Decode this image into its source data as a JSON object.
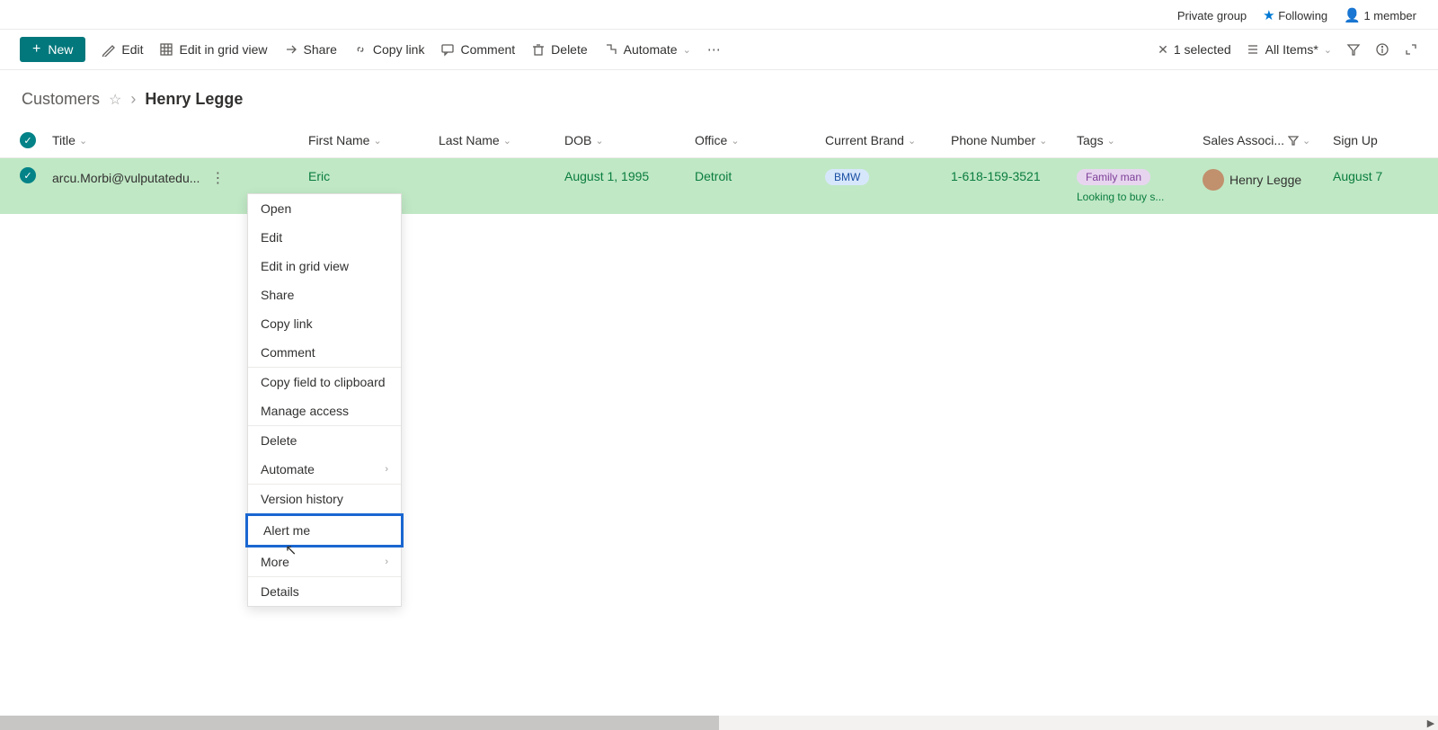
{
  "top": {
    "privacy": "Private group",
    "following": "Following",
    "members": "1 member"
  },
  "actions": {
    "new": "New",
    "edit": "Edit",
    "editGrid": "Edit in grid view",
    "share": "Share",
    "copyLink": "Copy link",
    "comment": "Comment",
    "delete": "Delete",
    "automate": "Automate",
    "selected": "1 selected",
    "viewName": "All Items*"
  },
  "breadcrumb": {
    "list": "Customers",
    "item": "Henry Legge"
  },
  "columns": {
    "title": "Title",
    "firstName": "First Name",
    "lastName": "Last Name",
    "dob": "DOB",
    "office": "Office",
    "brand": "Current Brand",
    "phone": "Phone Number",
    "tags": "Tags",
    "sales": "Sales Associ...",
    "signup": "Sign Up"
  },
  "row": {
    "title": "arcu.Morbi@vulputatedu...",
    "firstName": "Eric",
    "lastName": "",
    "dob": "August 1, 1995",
    "office": "Detroit",
    "brand": "BMW",
    "phone": "1-618-159-3521",
    "tag1": "Family man",
    "tag2": "Looking to buy s...",
    "salesAssociate": "Henry Legge",
    "signup": "August 7"
  },
  "menu": {
    "open": "Open",
    "edit": "Edit",
    "editGrid": "Edit in grid view",
    "share": "Share",
    "copyLink": "Copy link",
    "comment": "Comment",
    "copyField": "Copy field to clipboard",
    "manageAccess": "Manage access",
    "delete": "Delete",
    "automate": "Automate",
    "versionHistory": "Version history",
    "alertMe": "Alert me",
    "more": "More",
    "details": "Details"
  }
}
